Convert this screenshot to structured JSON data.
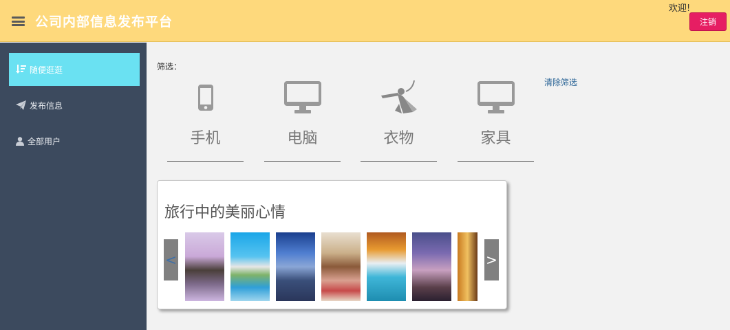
{
  "header": {
    "title": "公司内部信息发布平台",
    "welcome": "欢迎!",
    "logout_label": "注销"
  },
  "sidebar": {
    "items": [
      {
        "label": "随便逛逛",
        "icon": "sort-down-icon"
      },
      {
        "label": "发布信息",
        "icon": "send-icon"
      },
      {
        "label": "全部用户",
        "icon": "user-icon"
      }
    ]
  },
  "filter": {
    "label": "筛选：",
    "clear_label": "清除筛选",
    "categories": [
      {
        "label": "手机",
        "icon": "mobile-icon"
      },
      {
        "label": "电脑",
        "icon": "monitor-icon"
      },
      {
        "label": "衣物",
        "icon": "clothes-icon"
      },
      {
        "label": "家具",
        "icon": "monitor-icon"
      }
    ]
  },
  "card": {
    "title": "旅行中的美丽心情",
    "prev_label": "<",
    "next_label": ">"
  },
  "colors": {
    "topbar": "#fed97c",
    "sidebar": "#3c4a5e",
    "active": "#6ae1f2",
    "logout": "#e61e63"
  }
}
